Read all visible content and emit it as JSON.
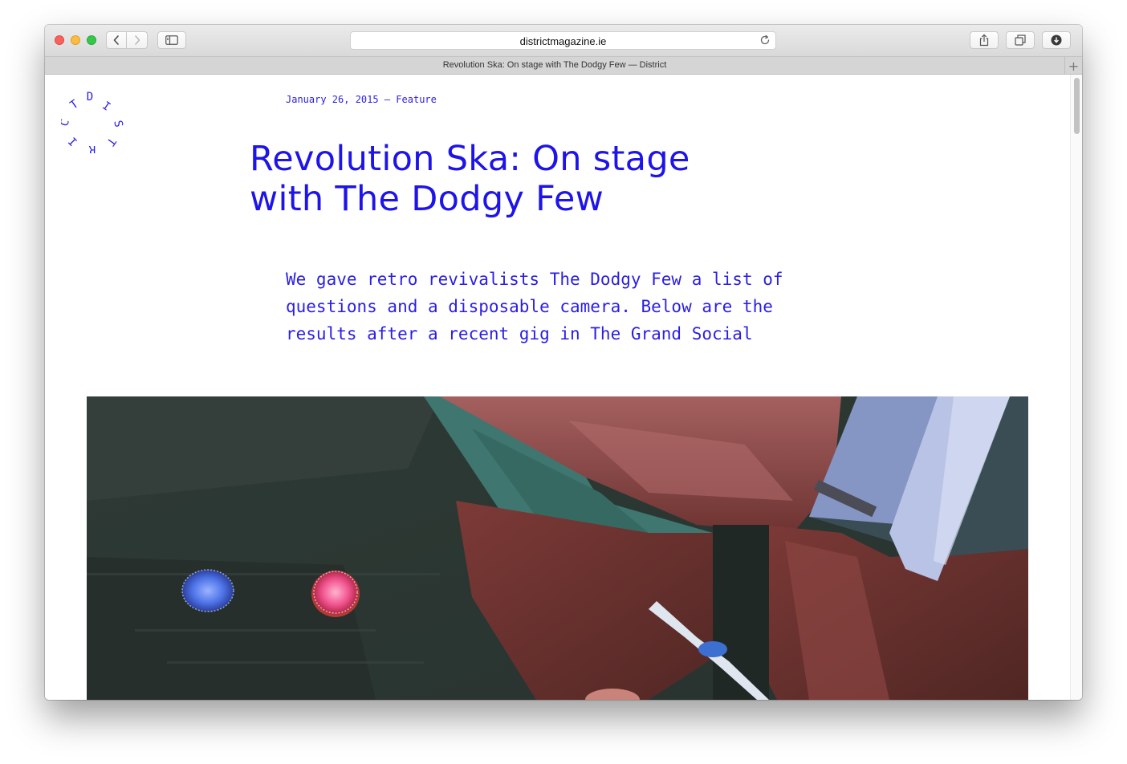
{
  "browser": {
    "url": "districtmagazine.ie",
    "tab_title": "Revolution Ska: On stage with The Dodgy Few — District",
    "new_tab_symbol": "+"
  },
  "site": {
    "logo_letters": [
      "D",
      "I",
      "S",
      "T",
      "R",
      "I",
      "C",
      "T"
    ]
  },
  "article": {
    "date": "January 26, 2015",
    "separator": "—",
    "category": "Feature",
    "title_line1": "Revolution Ska: On stage",
    "title_line2": "with The Dodgy Few",
    "standfirst": "We gave retro revivalists The Dodgy Few a list of questions and a disposable camera. Below are the results after a recent gig in The Grand Social"
  },
  "colors": {
    "accent": "#1e14ea",
    "close": "#fc605c",
    "minimize": "#fdbc40",
    "zoom": "#34c84a"
  },
  "icons": {
    "back": "chevron-left-icon",
    "forward": "chevron-right-icon",
    "sidebar": "sidebar-icon",
    "reload": "reload-icon",
    "share": "share-icon",
    "tabs": "tab-overview-icon",
    "download": "download-icon"
  }
}
